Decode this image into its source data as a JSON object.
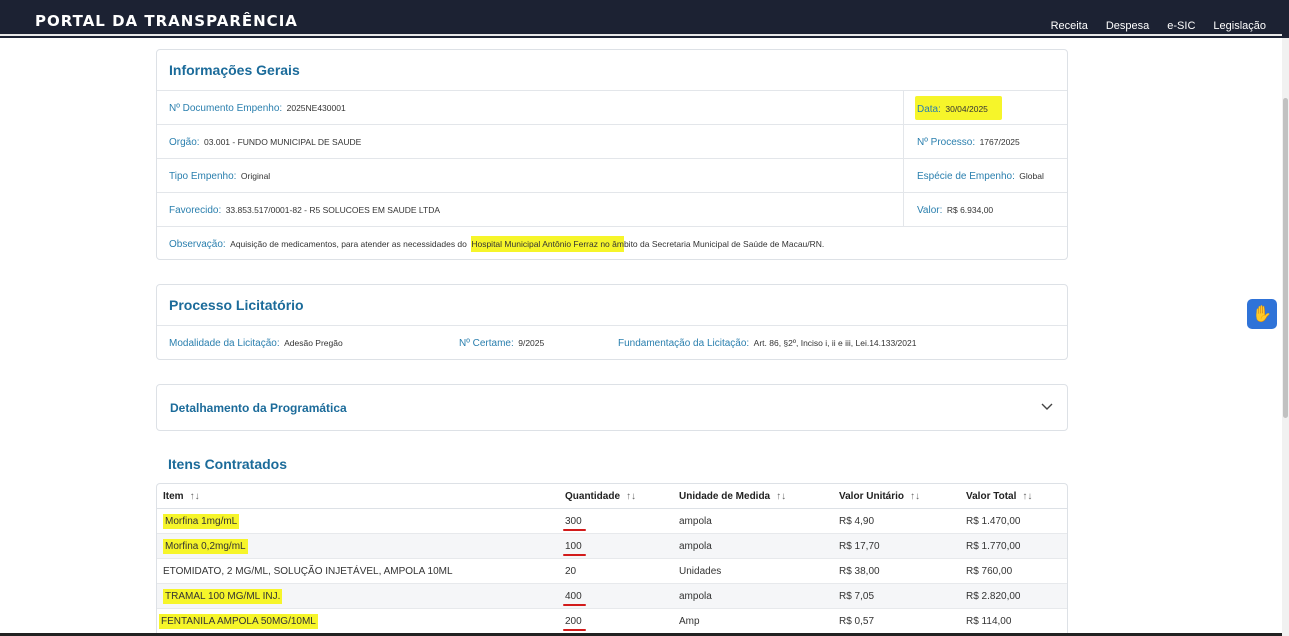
{
  "header": {
    "brand": "PORTAL DA TRANSPARÊNCIA",
    "nav": [
      "Receita",
      "Despesa",
      "e-SIC",
      "Legislação"
    ]
  },
  "info": {
    "title": "Informações Gerais",
    "documento_label": "Nº Documento Empenho:",
    "documento_value": "2025NE430001",
    "data_label": "Data:",
    "data_value": "30/04/2025",
    "orgao_label": "Orgão:",
    "orgao_value": "03.001 - FUNDO MUNICIPAL DE SAUDE",
    "processo_label": "Nº Processo:",
    "processo_value": "1767/2025",
    "tipo_label": "Tipo Empenho:",
    "tipo_value": "Original",
    "especie_label": "Espécie de Empenho:",
    "especie_value": "Global",
    "favorecido_label": "Favorecido:",
    "favorecido_value": "33.853.517/0001-82 - R5 SOLUCOES EM SAUDE LTDA",
    "valor_label": "Valor:",
    "valor_value": "R$ 6.934,00",
    "obs_label": "Observação:",
    "obs_pre": "Aquisição de medicamentos, para atender as necessidades do",
    "obs_hl": "Hospital Municipal Antônio Ferraz no âm",
    "obs_post": "bito da Secretaria Municipal de Saúde de Macau/RN."
  },
  "processo": {
    "title": "Processo Licitatório",
    "modalidade_label": "Modalidade da Licitação:",
    "modalidade_value": "Adesão Pregão",
    "certame_label": "Nº Certame:",
    "certame_value": "9/2025",
    "fundamentacao_label": "Fundamentação da Licitação:",
    "fundamentacao_value": "Art. 86, §2º, Inciso i, ii e iii, Lei.14.133/2021"
  },
  "programatica": {
    "title": "Detalhamento da Programática"
  },
  "itens": {
    "title": "Itens Contratados",
    "headers": [
      "Item",
      "Quantidade",
      "Unidade de Medida",
      "Valor Unitário",
      "Valor Total"
    ],
    "sort_glyph": "↑↓",
    "rows": [
      {
        "item": "Morfina 1mg/mL",
        "qtd": "300",
        "unidade": "ampola",
        "unitario": "R$ 4,90",
        "total": "R$ 1.470,00"
      },
      {
        "item": "Morfina 0,2mg/mL",
        "qtd": "100",
        "unidade": "ampola",
        "unitario": "R$ 17,70",
        "total": "R$ 1.770,00"
      },
      {
        "item": "ETOMIDATO, 2 MG/ML, SOLUÇÃO INJETÁVEL, AMPOLA 10ML",
        "qtd": "20",
        "unidade": "Unidades",
        "unitario": "R$ 38,00",
        "total": "R$ 760,00"
      },
      {
        "item": "TRAMAL 100 MG/ML INJ.",
        "qtd": "400",
        "unidade": "ampola",
        "unitario": "R$ 7,05",
        "total": "R$ 2.820,00"
      },
      {
        "item": "FENTANILA AMPOLA 50MG/10ML",
        "qtd": "200",
        "unidade": "Amp",
        "unitario": "R$ 0,57",
        "total": "R$ 114,00"
      }
    ]
  },
  "accessibility": {
    "icon": "hand-sign-icon",
    "glyph": "✋"
  }
}
